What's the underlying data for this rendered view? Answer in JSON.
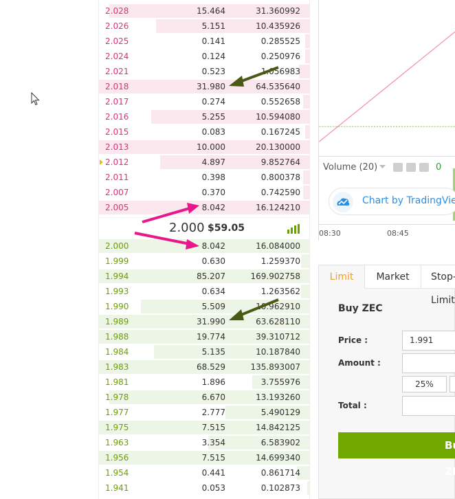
{
  "order_book": {
    "asks": [
      {
        "price": "2.028",
        "amount": "15.464",
        "total": "31.360992",
        "depth": 0.95
      },
      {
        "price": "2.026",
        "amount": "5.151",
        "total": "10.435926",
        "depth": 0.73
      },
      {
        "price": "2.025",
        "amount": "0.141",
        "total": "0.285525",
        "depth": 0.02
      },
      {
        "price": "2.024",
        "amount": "0.124",
        "total": "0.250976",
        "depth": 0.02
      },
      {
        "price": "2.021",
        "amount": "0.523",
        "total": "1.056983",
        "depth": 0.05
      },
      {
        "price": "2.018",
        "amount": "31.980",
        "total": "64.535640",
        "depth": 1.0
      },
      {
        "price": "2.017",
        "amount": "0.274",
        "total": "0.552658",
        "depth": 0.03
      },
      {
        "price": "2.016",
        "amount": "5.255",
        "total": "10.594080",
        "depth": 0.75
      },
      {
        "price": "2.015",
        "amount": "0.083",
        "total": "0.167245",
        "depth": 0.02
      },
      {
        "price": "2.013",
        "amount": "10.000",
        "total": "20.130000",
        "depth": 1.0
      },
      {
        "price": "2.012",
        "amount": "4.897",
        "total": "9.852764",
        "depth": 0.71
      },
      {
        "price": "2.011",
        "amount": "0.398",
        "total": "0.800378",
        "depth": 0.03
      },
      {
        "price": "2.007",
        "amount": "0.370",
        "total": "0.742590",
        "depth": 0.03
      },
      {
        "price": "2.005",
        "amount": "8.042",
        "total": "16.124210",
        "depth": 1.0
      }
    ],
    "bids": [
      {
        "price": "2.000",
        "amount": "8.042",
        "total": "16.084000",
        "depth": 1.0
      },
      {
        "price": "1.999",
        "amount": "0.630",
        "total": "1.259370",
        "depth": 0.04
      },
      {
        "price": "1.994",
        "amount": "85.207",
        "total": "169.902758",
        "depth": 1.0
      },
      {
        "price": "1.993",
        "amount": "0.634",
        "total": "1.263562",
        "depth": 0.04
      },
      {
        "price": "1.990",
        "amount": "5.509",
        "total": "10.962910",
        "depth": 0.8
      },
      {
        "price": "1.989",
        "amount": "31.990",
        "total": "63.628110",
        "depth": 1.0
      },
      {
        "price": "1.988",
        "amount": "19.774",
        "total": "39.310712",
        "depth": 1.0
      },
      {
        "price": "1.984",
        "amount": "5.135",
        "total": "10.187840",
        "depth": 0.74
      },
      {
        "price": "1.983",
        "amount": "68.529",
        "total": "135.893007",
        "depth": 1.0
      },
      {
        "price": "1.981",
        "amount": "1.896",
        "total": "3.755976",
        "depth": 0.27
      },
      {
        "price": "1.978",
        "amount": "6.670",
        "total": "13.193260",
        "depth": 0.95
      },
      {
        "price": "1.977",
        "amount": "2.777",
        "total": "5.490129",
        "depth": 0.4
      },
      {
        "price": "1.975",
        "amount": "7.515",
        "total": "14.842125",
        "depth": 1.0
      },
      {
        "price": "1.963",
        "amount": "3.354",
        "total": "6.583902",
        "depth": 0.48
      },
      {
        "price": "1.956",
        "amount": "7.515",
        "total": "14.699340",
        "depth": 1.0
      },
      {
        "price": "1.954",
        "amount": "0.441",
        "total": "0.861714",
        "depth": 0.06
      },
      {
        "price": "1.941",
        "amount": "0.053",
        "total": "0.102873",
        "depth": 0.01
      }
    ],
    "last_price": "2.000",
    "usd_price": "$59.05"
  },
  "chart": {
    "volume_label": "Volume (20)",
    "volume_value": "0",
    "tradingview_text": "Chart by TradingView",
    "time_ticks": [
      "08:30",
      "08:45"
    ]
  },
  "trade_form": {
    "tabs": [
      "Limit",
      "Market",
      "Stop-Limit"
    ],
    "buy_title": "Buy ZEC",
    "price_label": "Price :",
    "price_value": "1.991",
    "amount_label": "Amount :",
    "percent_label": "25%",
    "total_label": "Total :",
    "buy_button": "Buy ZEC"
  },
  "colors": {
    "ask": "#e0307a",
    "bid": "#6aa100",
    "accent": "#f0a11e",
    "arrow_pink": "#e8188c",
    "arrow_olive": "#4a5a14"
  }
}
